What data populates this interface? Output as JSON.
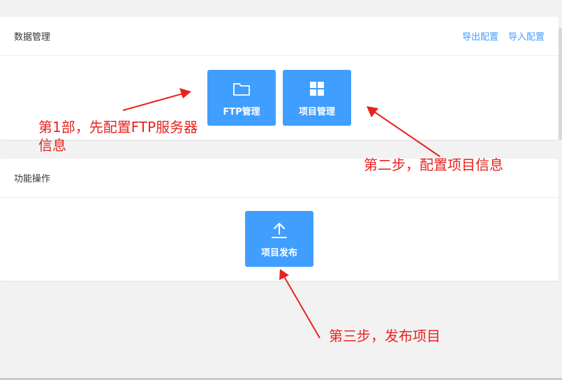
{
  "data_section": {
    "title": "数据管理",
    "export_label": "导出配置",
    "import_label": "导入配置",
    "tiles": [
      {
        "label": "FTP管理",
        "icon": "folder-icon"
      },
      {
        "label": "项目管理",
        "icon": "grid-icon"
      }
    ]
  },
  "ops_section": {
    "title": "功能操作",
    "tiles": [
      {
        "label": "项目发布",
        "icon": "upload-icon"
      }
    ]
  },
  "annotations": {
    "step1_line1": "第1部，先配置FTP服务器",
    "step1_line2": "信息",
    "step2": "第二步，配置项目信息",
    "step3": "第三步，发布项目"
  },
  "colors": {
    "accent": "#409eff",
    "annotation": "#e8231f",
    "background": "#f2f2f2"
  }
}
